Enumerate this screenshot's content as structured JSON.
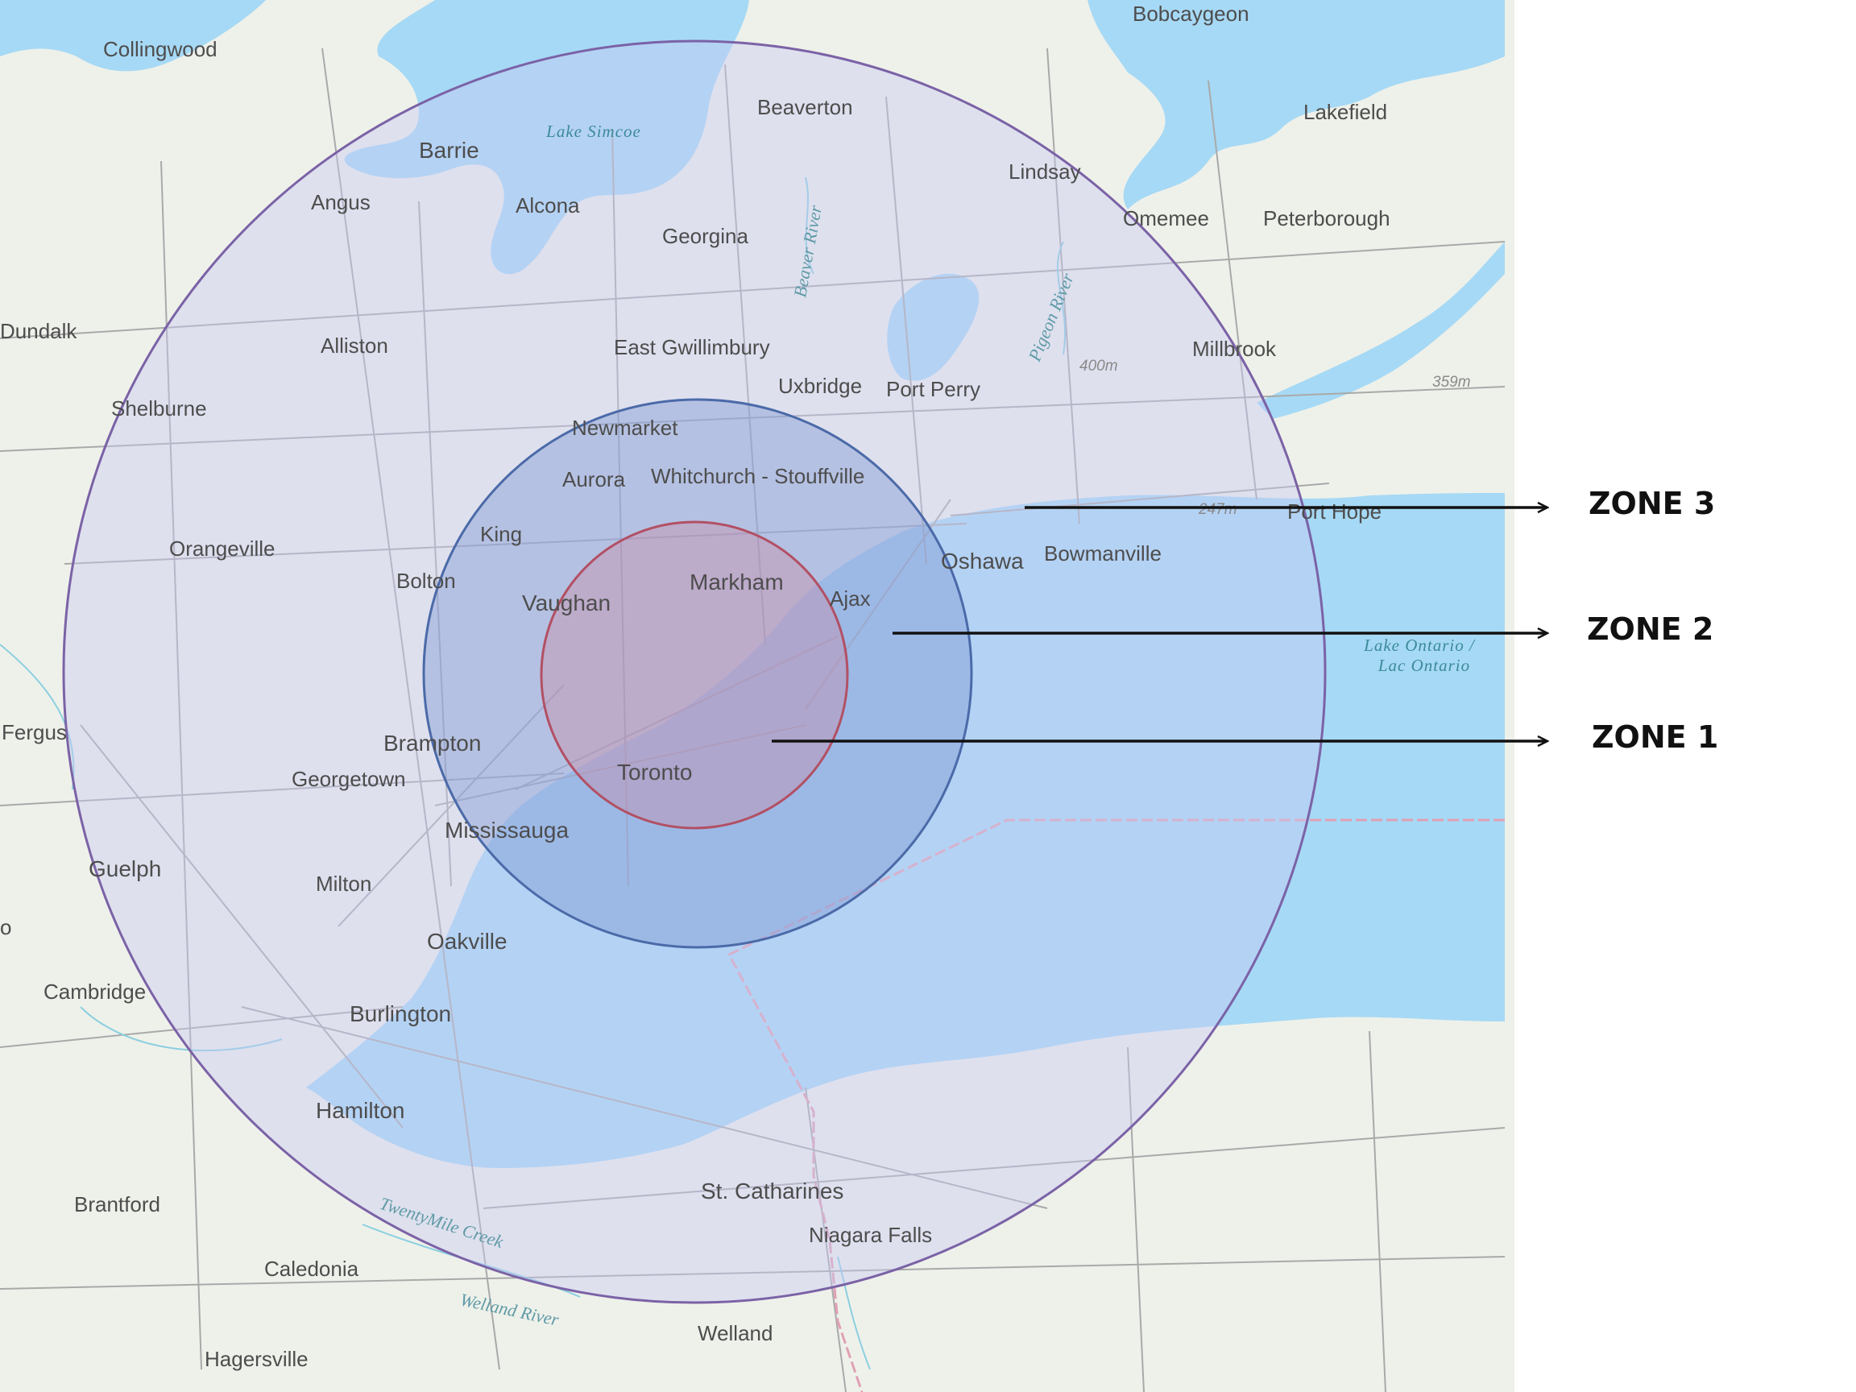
{
  "map": {
    "basemap": "topographic",
    "water_labels": {
      "lake_simcoe": "Lake Simcoe",
      "lake_ontario_line1": "Lake Ontario /",
      "lake_ontario_line2": "Lac Ontario"
    },
    "river_labels": {
      "twenty_mile": "TwentyMile Creek",
      "welland": "Welland River",
      "beaver": "Beaver River",
      "pigeon": "Pigeon River"
    },
    "elevations": [
      "400m",
      "359m",
      "247m"
    ],
    "places": [
      {
        "id": "bobcaygeon",
        "name": "Bobcaygeon"
      },
      {
        "id": "collingwood",
        "name": "Collingwood"
      },
      {
        "id": "beaverton",
        "name": "Beaverton"
      },
      {
        "id": "lakefield",
        "name": "Lakefield"
      },
      {
        "id": "barrie",
        "name": "Barrie"
      },
      {
        "id": "lindsay",
        "name": "Lindsay"
      },
      {
        "id": "angus",
        "name": "Angus"
      },
      {
        "id": "alcona",
        "name": "Alcona"
      },
      {
        "id": "omemee",
        "name": "Omemee"
      },
      {
        "id": "peterborough",
        "name": "Peterborough"
      },
      {
        "id": "georgina",
        "name": "Georgina"
      },
      {
        "id": "dundalk",
        "name": "Dundalk"
      },
      {
        "id": "alliston",
        "name": "Alliston"
      },
      {
        "id": "east_gwillimbury",
        "name": "East Gwillimbury"
      },
      {
        "id": "millbrook",
        "name": "Millbrook"
      },
      {
        "id": "uxbridge",
        "name": "Uxbridge"
      },
      {
        "id": "port_perry",
        "name": "Port Perry"
      },
      {
        "id": "shelburne",
        "name": "Shelburne"
      },
      {
        "id": "newmarket",
        "name": "Newmarket"
      },
      {
        "id": "aurora",
        "name": "Aurora"
      },
      {
        "id": "whitchurch",
        "name": "Whitchurch - Stouffville"
      },
      {
        "id": "port_hope",
        "name": "Port Hope"
      },
      {
        "id": "king",
        "name": "King"
      },
      {
        "id": "orangeville",
        "name": "Orangeville"
      },
      {
        "id": "oshawa",
        "name": "Oshawa"
      },
      {
        "id": "bowmanville",
        "name": "Bowmanville"
      },
      {
        "id": "bolton",
        "name": "Bolton"
      },
      {
        "id": "markham",
        "name": "Markham"
      },
      {
        "id": "ajax",
        "name": "Ajax"
      },
      {
        "id": "vaughan",
        "name": "Vaughan"
      },
      {
        "id": "fergus",
        "name": "Fergus"
      },
      {
        "id": "brampton",
        "name": "Brampton"
      },
      {
        "id": "georgetown",
        "name": "Georgetown"
      },
      {
        "id": "toronto",
        "name": "Toronto"
      },
      {
        "id": "mississauga",
        "name": "Mississauga"
      },
      {
        "id": "guelph",
        "name": "Guelph"
      },
      {
        "id": "milton",
        "name": "Milton"
      },
      {
        "id": "oakville",
        "name": "Oakville"
      },
      {
        "id": "cambridge",
        "name": "Cambridge"
      },
      {
        "id": "burlington",
        "name": "Burlington"
      },
      {
        "id": "hamilton",
        "name": "Hamilton"
      },
      {
        "id": "st_catharines",
        "name": "St. Catharines"
      },
      {
        "id": "brantford",
        "name": "Brantford"
      },
      {
        "id": "niagara_falls",
        "name": "Niagara Falls"
      },
      {
        "id": "caledonia",
        "name": "Caledonia"
      },
      {
        "id": "welland",
        "name": "Welland"
      },
      {
        "id": "hagersville",
        "name": "Hagersville"
      },
      {
        "id": "edge_o",
        "name": "o"
      }
    ]
  },
  "zones": [
    {
      "id": "zone3",
      "label": "ZONE 3",
      "fill": "#c6c6f0",
      "stroke": "#7b62a6"
    },
    {
      "id": "zone2",
      "label": "ZONE 2",
      "fill": "#8fa6d8",
      "stroke": "#4b6aa8"
    },
    {
      "id": "zone1",
      "label": "ZONE 1",
      "fill": "#b78ab0",
      "stroke": "#b25064"
    }
  ],
  "colors": {
    "land": "#eef1ea",
    "water": "#a6d9f5",
    "border": "#e0a0b4",
    "arrow": "#111111"
  }
}
